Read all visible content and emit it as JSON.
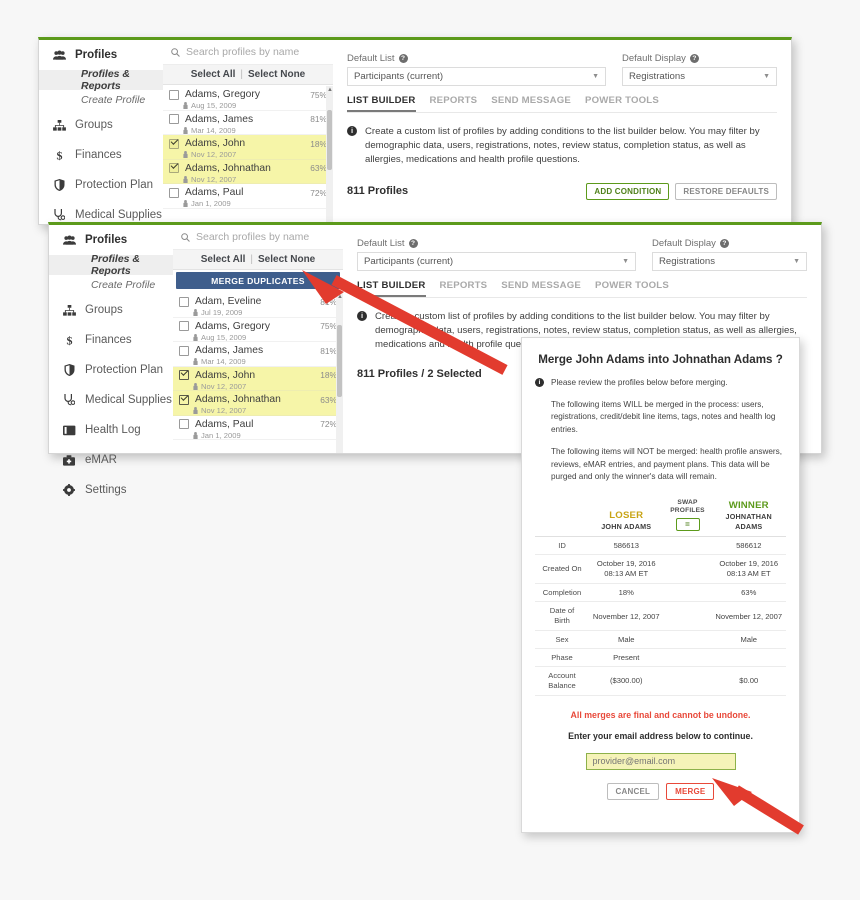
{
  "window1": {
    "sidebar": {
      "header": "Profiles",
      "sub_items": [
        "Profiles & Reports",
        "Create Profile"
      ],
      "items": [
        "Groups",
        "Finances",
        "Protection Plan",
        "Medical Supplies",
        "Health Log"
      ]
    },
    "list": {
      "search_placeholder": "Search profiles by name",
      "select_all": "Select All",
      "separator": "|",
      "select_none": "Select None",
      "profiles": [
        {
          "name": "Adams, Gregory",
          "pct": "75%",
          "dob": "Aug 15, 2009",
          "checked": false,
          "highlight": false
        },
        {
          "name": "Adams, James",
          "pct": "81%",
          "dob": "Mar 14, 2009",
          "checked": false,
          "highlight": false
        },
        {
          "name": "Adams, John",
          "pct": "18%",
          "dob": "Nov 12, 2007",
          "checked": false,
          "highlight": true
        },
        {
          "name": "Adams, Johnathan",
          "pct": "63%",
          "dob": "Nov 12, 2007",
          "checked": false,
          "highlight": true
        },
        {
          "name": "Adams, Paul",
          "pct": "72%",
          "dob": "Jan 1, 2009",
          "checked": false,
          "highlight": false
        }
      ]
    },
    "main": {
      "default_list_label": "Default List",
      "default_list_value": "Participants (current)",
      "default_display_label": "Default Display",
      "default_display_value": "Registrations",
      "tabs": [
        {
          "label": "LIST BUILDER",
          "active": true
        },
        {
          "label": "REPORTS",
          "active": false
        },
        {
          "label": "SEND MESSAGE",
          "active": false
        },
        {
          "label": "POWER TOOLS",
          "active": false
        }
      ],
      "info_text": "Create a custom list of profiles by adding conditions to the list builder below. You may filter by demographic data, users, registrations, notes, review status, completion status, as well as allergies, medications and health profile questions.",
      "count": "811 Profiles",
      "add_condition": "ADD CONDITION",
      "restore_defaults": "RESTORE DEFAULTS"
    }
  },
  "window2": {
    "sidebar": {
      "header": "Profiles",
      "sub_items": [
        "Profiles & Reports",
        "Create Profile"
      ],
      "items": [
        "Groups",
        "Finances",
        "Protection Plan",
        "Medical Supplies",
        "Health Log",
        "eMAR",
        "Settings"
      ]
    },
    "list": {
      "search_placeholder": "Search profiles by name",
      "select_all": "Select All",
      "separator": "|",
      "select_none": "Select None",
      "merge_duplicates": "MERGE DUPLICATES",
      "profiles": [
        {
          "name": "Adam, Eveline",
          "pct": "81%",
          "dob": "Jul 19, 2009",
          "checked": false,
          "highlight": false
        },
        {
          "name": "Adams, Gregory",
          "pct": "75%",
          "dob": "Aug 15, 2009",
          "checked": false,
          "highlight": false
        },
        {
          "name": "Adams, James",
          "pct": "81%",
          "dob": "Mar 14, 2009",
          "checked": false,
          "highlight": false
        },
        {
          "name": "Adams, John",
          "pct": "18%",
          "dob": "Nov 12, 2007",
          "checked": true,
          "highlight": true
        },
        {
          "name": "Adams, Johnathan",
          "pct": "63%",
          "dob": "Nov 12, 2007",
          "checked": true,
          "highlight": true
        },
        {
          "name": "Adams, Paul",
          "pct": "72%",
          "dob": "Jan 1, 2009",
          "checked": false,
          "highlight": false
        }
      ]
    },
    "main": {
      "default_list_label": "Default List",
      "default_list_value": "Participants (current)",
      "default_display_label": "Default Display",
      "default_display_value": "Registrations",
      "tabs": [
        {
          "label": "LIST BUILDER",
          "active": true
        },
        {
          "label": "REPORTS",
          "active": false
        },
        {
          "label": "SEND MESSAGE",
          "active": false
        },
        {
          "label": "POWER TOOLS",
          "active": false
        }
      ],
      "info_text": "Create a custom list of profiles by adding conditions to the list builder below. You may filter by demographic data, users, registrations, notes, review status, completion status, as well as allergies, medications and health profile questions.",
      "count": "811 Profiles / 2 Selected"
    }
  },
  "dialog": {
    "title": "Merge John Adams into Johnathan Adams ?",
    "note": "Please review the profiles below before merging.",
    "para1": "The following items WILL be merged in the process: users, registrations, credit/debit line items, tags, notes and health log entries.",
    "para2": "The following items will NOT be merged: health profile answers, reviews, eMAR entries, and payment plans. This data will be purged and only the winner's data will remain.",
    "loser_label": "LOSER",
    "loser_name": "JOHN ADAMS",
    "swap_label_line1": "SWAP",
    "swap_label_line2": "PROFILES",
    "swap_icon": "=",
    "winner_label": "WINNER",
    "winner_name_line1": "JOHNATHAN",
    "winner_name_line2": "ADAMS",
    "rows": [
      {
        "label": "ID",
        "loser": "586613",
        "winner": "586612"
      },
      {
        "label": "Created On",
        "loser": "October 19, 2016\n08:13 AM ET",
        "winner": "October 19, 2016\n08:13 AM ET"
      },
      {
        "label": "Completion",
        "loser": "18%",
        "winner": "63%"
      },
      {
        "label": "Date of\nBirth",
        "loser": "November 12, 2007",
        "winner": "November 12, 2007"
      },
      {
        "label": "Sex",
        "loser": "Male",
        "winner": "Male"
      },
      {
        "label": "Phase",
        "loser": "Present",
        "winner": ""
      },
      {
        "label": "Account\nBalance",
        "loser": "($300.00)",
        "winner": "$0.00"
      }
    ],
    "warning": "All merges are final and cannot be undone.",
    "instruction": "Enter your email address below to continue.",
    "email_placeholder": "provider@email.com",
    "email_value": "",
    "cancel_label": "CANCEL",
    "merge_label": "MERGE",
    "accent_green": "#5c9a1b",
    "accent_red": "#e8493a",
    "accent_gold": "#c8a415"
  }
}
